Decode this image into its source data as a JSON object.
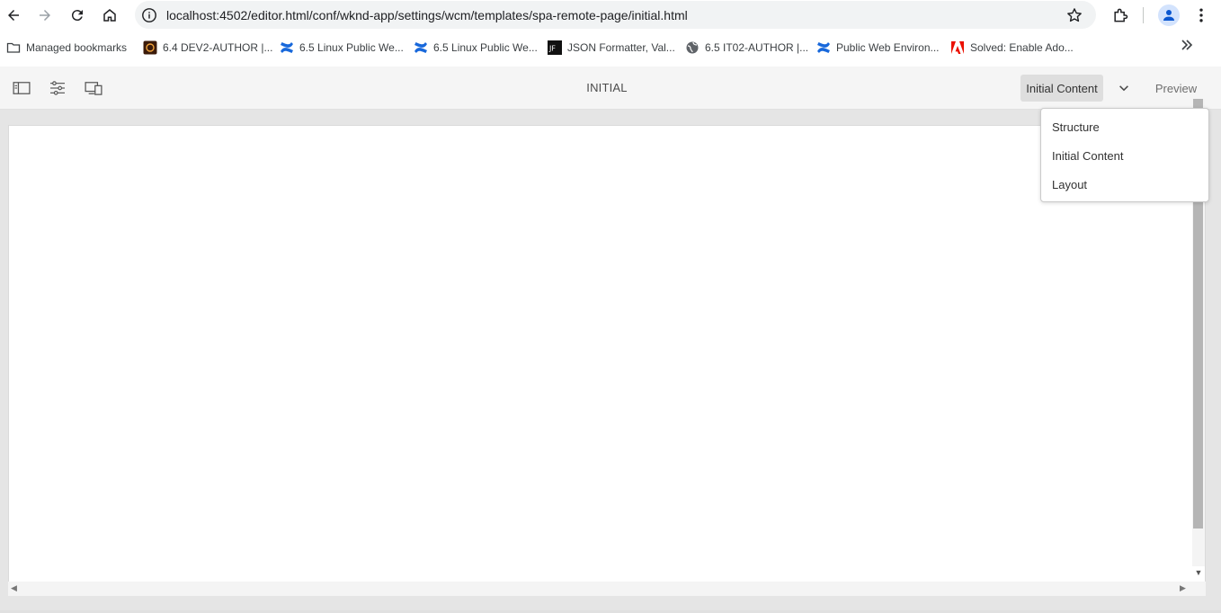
{
  "browser": {
    "url": "localhost:4502/editor.html/conf/wknd-app/settings/wcm/templates/spa-remote-page/initial.html"
  },
  "bookmarks": [
    {
      "label": "Managed bookmarks",
      "icon": "folder-icon"
    },
    {
      "label": "6.4 DEV2-AUTHOR |...",
      "icon": "aem-icon"
    },
    {
      "label": "6.5 Linux Public We...",
      "icon": "confluence-icon"
    },
    {
      "label": "6.5 Linux Public We...",
      "icon": "confluence-icon"
    },
    {
      "label": "JSON Formatter, Val...",
      "icon": "jf-icon"
    },
    {
      "label": "6.5 IT02-AUTHOR |...",
      "icon": "globe-icon"
    },
    {
      "label": "Public Web Environ...",
      "icon": "confluence-icon"
    },
    {
      "label": "Solved: Enable Ado...",
      "icon": "adobe-icon"
    }
  ],
  "editor": {
    "title": "INITIAL",
    "mode_label": "Initial Content",
    "preview_label": "Preview"
  },
  "mode_menu": {
    "items": [
      "Structure",
      "Initial Content",
      "Layout"
    ]
  },
  "colors": {
    "confluence_blue": "#1868db",
    "adobe_red": "#eb1000",
    "toolbar_bg": "#f5f5f5"
  }
}
